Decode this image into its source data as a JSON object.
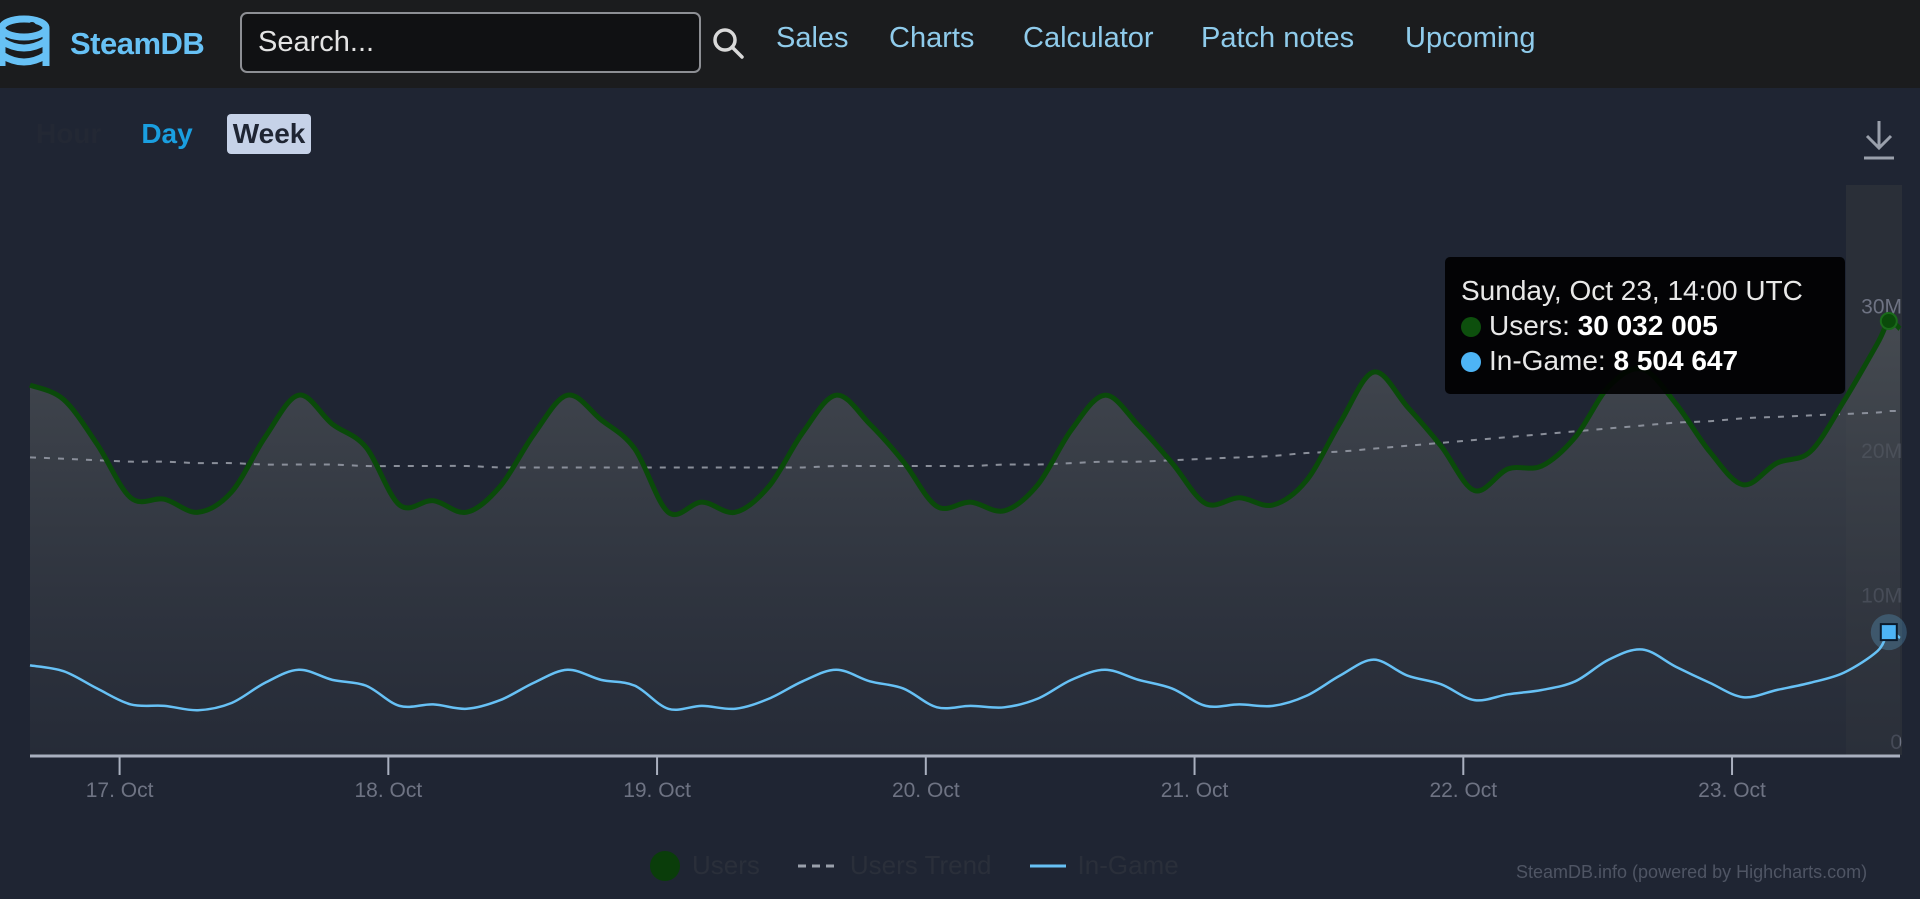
{
  "header": {
    "logo_text": "SteamDB",
    "search_placeholder": "Search...",
    "nav": [
      "Sales",
      "Charts",
      "Calculator",
      "Patch notes",
      "Upcoming"
    ]
  },
  "range_buttons": [
    {
      "label": "Hour",
      "state": "disabled"
    },
    {
      "label": "Day",
      "state": "link"
    },
    {
      "label": "Week",
      "state": "selected"
    }
  ],
  "tooltip": {
    "date": "Sunday, Oct 23, 14:00 UTC",
    "users_label": "Users:",
    "users_value": "30 032 005",
    "ingame_label": "In-Game:",
    "ingame_value": "8 504 647"
  },
  "legend": [
    "Users",
    "Users Trend",
    "In-Game"
  ],
  "credits": "SteamDB.info (powered by Highcharts.com)",
  "colors": {
    "users": "#0a4a0a",
    "users_dot": "#0d5a0d",
    "ingame": "#67c1f5",
    "trend": "#8a8f9a"
  },
  "chart_data": {
    "type": "area",
    "title": "",
    "xlabel": "",
    "ylabel": "",
    "x_unit": "hours since 16 Oct 00:00 UTC",
    "x_ticks": [
      {
        "hour": 24,
        "label": "17. Oct"
      },
      {
        "hour": 48,
        "label": "18. Oct"
      },
      {
        "hour": 72,
        "label": "19. Oct"
      },
      {
        "hour": 96,
        "label": "20. Oct"
      },
      {
        "hour": 120,
        "label": "21. Oct"
      },
      {
        "hour": 144,
        "label": "22. Oct"
      },
      {
        "hour": 168,
        "label": "23. Oct"
      }
    ],
    "y_ticks": [
      {
        "value": 0,
        "label": "0"
      },
      {
        "value": 10000000,
        "label": "10M"
      },
      {
        "value": 20000000,
        "label": "20M"
      },
      {
        "value": 30000000,
        "label": "30M"
      }
    ],
    "xlim": [
      16,
      183
    ],
    "ylim": [
      0,
      32500000
    ],
    "grid": false,
    "legend_position": "bottom-center",
    "x": [
      16,
      19,
      22,
      25,
      28,
      31,
      34,
      37,
      40,
      43,
      46,
      49,
      52,
      55,
      58,
      61,
      64,
      67,
      70,
      73,
      76,
      79,
      82,
      85,
      88,
      91,
      94,
      97,
      100,
      103,
      106,
      109,
      112,
      115,
      118,
      121,
      124,
      127,
      130,
      133,
      136,
      139,
      142,
      145,
      148,
      151,
      154,
      157,
      160,
      163,
      166,
      169,
      172,
      175,
      178,
      181,
      182,
      183
    ],
    "series": [
      {
        "name": "Users",
        "values": [
          25.6,
          24.6,
          21.5,
          17.8,
          17.7,
          16.8,
          18.2,
          22.0,
          24.9,
          22.9,
          21.3,
          17.3,
          17.6,
          16.8,
          18.6,
          22.2,
          24.9,
          23.2,
          21.2,
          16.8,
          17.5,
          16.8,
          18.6,
          22.3,
          24.9,
          22.9,
          20.3,
          17.2,
          17.5,
          16.9,
          18.7,
          22.5,
          24.9,
          22.8,
          20.2,
          17.4,
          17.8,
          17.3,
          19.0,
          23.0,
          26.5,
          24.1,
          21.4,
          18.3,
          19.8,
          20.0,
          22.0,
          25.5,
          26.7,
          24.3,
          21.0,
          18.7,
          20.2,
          21.0,
          24.5,
          28.5,
          30.0,
          29.5
        ]
      },
      {
        "name": "Users Trend",
        "values": [
          20.6,
          20.5,
          20.4,
          20.3,
          20.3,
          20.2,
          20.2,
          20.1,
          20.1,
          20.1,
          20.0,
          20.0,
          20.0,
          20.0,
          19.9,
          19.9,
          19.9,
          19.9,
          19.9,
          19.9,
          19.9,
          19.9,
          19.9,
          19.9,
          20.0,
          20.0,
          20.0,
          20.0,
          20.0,
          20.1,
          20.1,
          20.2,
          20.3,
          20.3,
          20.4,
          20.5,
          20.6,
          20.7,
          20.9,
          21.0,
          21.2,
          21.4,
          21.6,
          21.8,
          22.0,
          22.2,
          22.4,
          22.6,
          22.8,
          23.0,
          23.1,
          23.3,
          23.4,
          23.5,
          23.6,
          23.7,
          23.8,
          23.8
        ]
      },
      {
        "name": "In-Game",
        "values": [
          6.2,
          5.8,
          4.6,
          3.5,
          3.4,
          3.1,
          3.6,
          5.0,
          5.9,
          5.2,
          4.8,
          3.4,
          3.5,
          3.2,
          3.8,
          5.0,
          5.9,
          5.2,
          4.8,
          3.2,
          3.4,
          3.2,
          3.9,
          5.1,
          5.9,
          5.1,
          4.6,
          3.3,
          3.4,
          3.3,
          3.9,
          5.2,
          5.9,
          5.2,
          4.6,
          3.4,
          3.5,
          3.4,
          4.1,
          5.5,
          6.6,
          5.5,
          4.9,
          3.8,
          4.2,
          4.5,
          5.1,
          6.6,
          7.3,
          6.1,
          5.0,
          4.0,
          4.5,
          5.0,
          5.7,
          7.2,
          8.5,
          8.1
        ]
      }
    ],
    "value_unit": "millions",
    "highlight_point": {
      "hour": 182,
      "users": 30032005,
      "in_game": 8504647
    }
  }
}
